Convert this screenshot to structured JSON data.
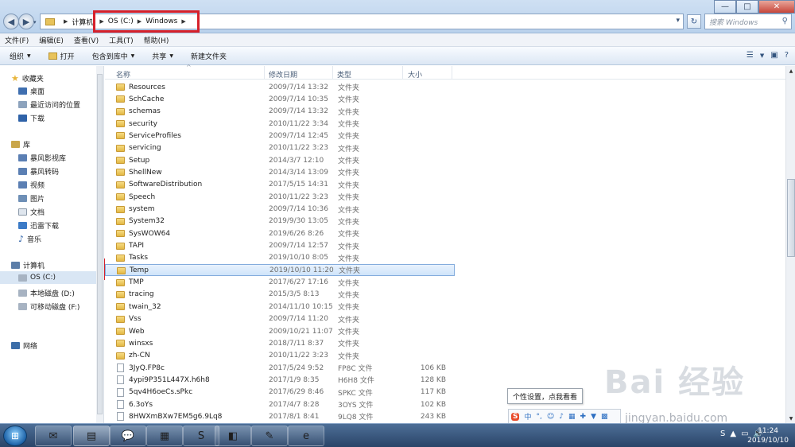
{
  "titlebar": {
    "window_buttons": {
      "minimize": "—",
      "maximize": "□",
      "close": "✕"
    },
    "nav": {
      "back": "◀",
      "forward": "▶",
      "dropdown": "▾"
    },
    "breadcrumb": [
      "计算机",
      "OS (C:)",
      "Windows"
    ],
    "search_placeholder": "搜索 Windows"
  },
  "menubar": [
    "文件(F)",
    "编辑(E)",
    "查看(V)",
    "工具(T)",
    "帮助(H)"
  ],
  "toolbar": {
    "organize": "组织",
    "open": "打开",
    "include_in_library": "包含到库中",
    "share": "共享",
    "new_folder": "新建文件夹"
  },
  "navpane": {
    "favorites": "收藏夹",
    "desktop": "桌面",
    "recent": "最近访问的位置",
    "downloads": "下载",
    "libraries": "库",
    "baofeng_video": "暴风影视库",
    "baofeng_convert": "暴风转码",
    "videos": "视频",
    "pictures": "图片",
    "documents": "文档",
    "xunlei": "迅雷下载",
    "music": "音乐",
    "computer": "计算机",
    "drive_c": "OS (C:)",
    "drive_d": "本地磁盘 (D:)",
    "drive_f": "可移动磁盘 (F:)",
    "network": "网络"
  },
  "columns": {
    "name": "名称",
    "date": "修改日期",
    "type": "类型",
    "size": "大小"
  },
  "files": [
    {
      "name": "Resources",
      "date": "2009/7/14 13:32",
      "type": "文件夹",
      "size": "",
      "kind": "folder"
    },
    {
      "name": "SchCache",
      "date": "2009/7/14 10:35",
      "type": "文件夹",
      "size": "",
      "kind": "folder"
    },
    {
      "name": "schemas",
      "date": "2009/7/14 13:32",
      "type": "文件夹",
      "size": "",
      "kind": "folder"
    },
    {
      "name": "security",
      "date": "2010/11/22 3:34",
      "type": "文件夹",
      "size": "",
      "kind": "folder"
    },
    {
      "name": "ServiceProfiles",
      "date": "2009/7/14 12:45",
      "type": "文件夹",
      "size": "",
      "kind": "folder"
    },
    {
      "name": "servicing",
      "date": "2010/11/22 3:23",
      "type": "文件夹",
      "size": "",
      "kind": "folder"
    },
    {
      "name": "Setup",
      "date": "2014/3/7 12:10",
      "type": "文件夹",
      "size": "",
      "kind": "folder"
    },
    {
      "name": "ShellNew",
      "date": "2014/3/14 13:09",
      "type": "文件夹",
      "size": "",
      "kind": "folder"
    },
    {
      "name": "SoftwareDistribution",
      "date": "2017/5/15 14:31",
      "type": "文件夹",
      "size": "",
      "kind": "folder"
    },
    {
      "name": "Speech",
      "date": "2010/11/22 3:23",
      "type": "文件夹",
      "size": "",
      "kind": "folder"
    },
    {
      "name": "system",
      "date": "2009/7/14 10:36",
      "type": "文件夹",
      "size": "",
      "kind": "folder"
    },
    {
      "name": "System32",
      "date": "2019/9/30 13:05",
      "type": "文件夹",
      "size": "",
      "kind": "folder"
    },
    {
      "name": "SysWOW64",
      "date": "2019/6/26 8:26",
      "type": "文件夹",
      "size": "",
      "kind": "folder"
    },
    {
      "name": "TAPI",
      "date": "2009/7/14 12:57",
      "type": "文件夹",
      "size": "",
      "kind": "folder"
    },
    {
      "name": "Tasks",
      "date": "2019/10/10 8:05",
      "type": "文件夹",
      "size": "",
      "kind": "folder"
    },
    {
      "name": "Temp",
      "date": "2019/10/10 11:20",
      "type": "文件夹",
      "size": "",
      "kind": "folder",
      "selected": true
    },
    {
      "name": "TMP",
      "date": "2017/6/27 17:16",
      "type": "文件夹",
      "size": "",
      "kind": "folder"
    },
    {
      "name": "tracing",
      "date": "2015/3/5 8:13",
      "type": "文件夹",
      "size": "",
      "kind": "folder"
    },
    {
      "name": "twain_32",
      "date": "2014/11/10 10:15",
      "type": "文件夹",
      "size": "",
      "kind": "folder"
    },
    {
      "name": "Vss",
      "date": "2009/7/14 11:20",
      "type": "文件夹",
      "size": "",
      "kind": "folder"
    },
    {
      "name": "Web",
      "date": "2009/10/21 11:07",
      "type": "文件夹",
      "size": "",
      "kind": "folder"
    },
    {
      "name": "winsxs",
      "date": "2018/7/11 8:37",
      "type": "文件夹",
      "size": "",
      "kind": "folder"
    },
    {
      "name": "zh-CN",
      "date": "2010/11/22 3:23",
      "type": "文件夹",
      "size": "",
      "kind": "folder"
    },
    {
      "name": "3JyQ.FP8c",
      "date": "2017/5/24 9:52",
      "type": "FP8C 文件",
      "size": "106 KB",
      "kind": "file"
    },
    {
      "name": "4ypi9P351L447X.h6h8",
      "date": "2017/1/9 8:35",
      "type": "H6H8 文件",
      "size": "128 KB",
      "kind": "file"
    },
    {
      "name": "5qv4H6oeCs.sPkc",
      "date": "2017/6/29 8:46",
      "type": "SPKC 文件",
      "size": "117 KB",
      "kind": "file"
    },
    {
      "name": "6.3oYs",
      "date": "2017/4/7 8:28",
      "type": "3OYS 文件",
      "size": "102 KB",
      "kind": "file"
    },
    {
      "name": "8HWXmBXw7EM5g6.9Lq8",
      "date": "2017/8/1 8:41",
      "type": "9LQ8 文件",
      "size": "243 KB",
      "kind": "file"
    }
  ],
  "tooltip": "个性设置，点我看看",
  "ime": {
    "logo": "S",
    "mode": "中",
    "punct": "°,",
    "emoji": "☺",
    "voice": "♪",
    "keyboard": "▦",
    "tools": "✚",
    "shirt": "▼",
    "grid": "▩"
  },
  "watermark": {
    "brand": "Bai 经验",
    "url": "jingyan.baidu.com"
  },
  "taskbar": {
    "start": "⊞",
    "apps": [
      "✉",
      "▤",
      "💬",
      "▦",
      "S",
      "◧",
      "✎",
      "e"
    ],
    "tray": [
      "S",
      "▲",
      "▭",
      "🔊"
    ]
  },
  "clock": {
    "time": "11:24",
    "date": "2019/10/10"
  }
}
